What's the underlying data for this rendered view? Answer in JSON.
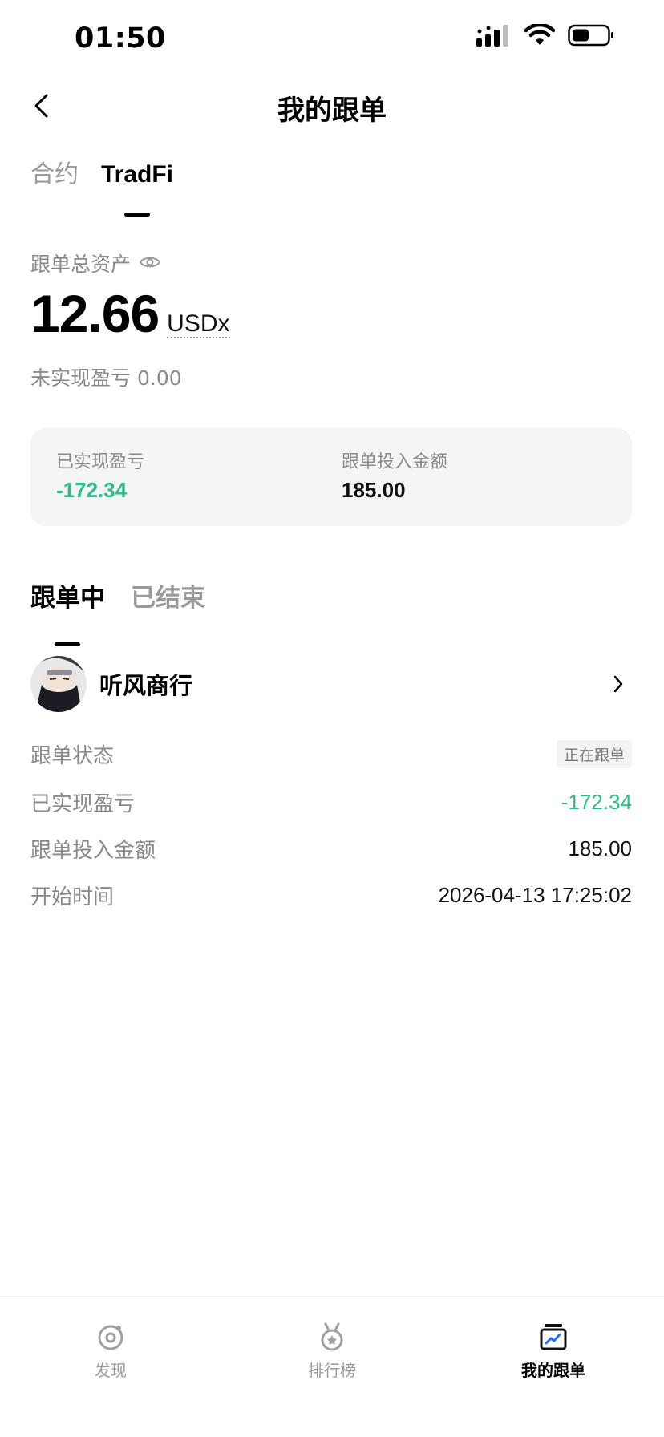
{
  "status_bar": {
    "time": "01:50",
    "battery_level": 0.45
  },
  "header": {
    "title": "我的跟单"
  },
  "top_tabs": [
    {
      "label": "合约",
      "active": false
    },
    {
      "label": "TradFi",
      "active": true
    }
  ],
  "assets": {
    "label": "跟单总资产",
    "value": "12.66",
    "unit": "USDx",
    "unrealized_label": "未实现盈亏",
    "unrealized_value": "0.00"
  },
  "summary": {
    "realized_label": "已实现盈亏",
    "realized_value": "-172.34",
    "invested_label": "跟单投入金额",
    "invested_value": "185.00"
  },
  "status_tabs": [
    {
      "label": "跟单中",
      "active": true
    },
    {
      "label": "已结束",
      "active": false
    }
  ],
  "trader": {
    "name": "听风商行",
    "details": {
      "status_label": "跟单状态",
      "status_value": "正在跟单",
      "realized_label": "已实现盈亏",
      "realized_value": "-172.34",
      "invested_label": "跟单投入金额",
      "invested_value": "185.00",
      "start_label": "开始时间",
      "start_value": "2026-04-13 17:25:02"
    }
  },
  "bottom_nav": [
    {
      "label": "发现",
      "icon": "discover-icon",
      "active": false
    },
    {
      "label": "排行榜",
      "icon": "ranking-icon",
      "active": false
    },
    {
      "label": "我的跟单",
      "icon": "my-copy-trade-icon",
      "active": true
    }
  ],
  "colors": {
    "profit_negative": "#2ebd85",
    "muted_text": "#8a8a8a",
    "card_bg": "#f3f5f6"
  }
}
